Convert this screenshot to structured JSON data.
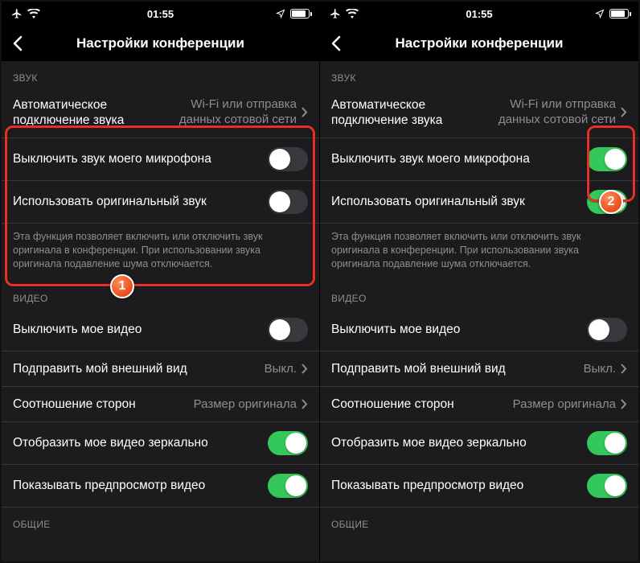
{
  "statusBar": {
    "time": "01:55"
  },
  "nav": {
    "title": "Настройки конференции"
  },
  "sections": {
    "sound": {
      "header": "ЗВУК",
      "autoConnect": {
        "label": "Автоматическое подключение звука",
        "value": "Wi-Fi или отправка данных сотовой сети"
      },
      "muteMic": "Выключить звук моего микрофона",
      "originalSound": "Использовать оригинальный звук",
      "note": "Эта функция позволяет включить или отключить звук оригинала в конференции. При использовании звука оригинала подавление шума отключается."
    },
    "video": {
      "header": "ВИДЕО",
      "muteVideo": "Выключить мое видео",
      "touchUp": {
        "label": "Подправить мой внешний вид",
        "value": "Выкл."
      },
      "aspect": {
        "label": "Соотношение сторон",
        "value": "Размер оригинала"
      },
      "mirror": "Отобразить мое видео зеркально",
      "preview": "Показывать предпросмотр видео"
    },
    "general": {
      "header": "ОБЩИЕ"
    }
  },
  "screens": [
    {
      "toggles": {
        "muteMic": false,
        "originalSound": false,
        "muteVideo": false,
        "mirror": true,
        "preview": true
      },
      "callout": "1"
    },
    {
      "toggles": {
        "muteMic": true,
        "originalSound": true,
        "muteVideo": false,
        "mirror": true,
        "preview": true
      },
      "callout": "2"
    }
  ]
}
